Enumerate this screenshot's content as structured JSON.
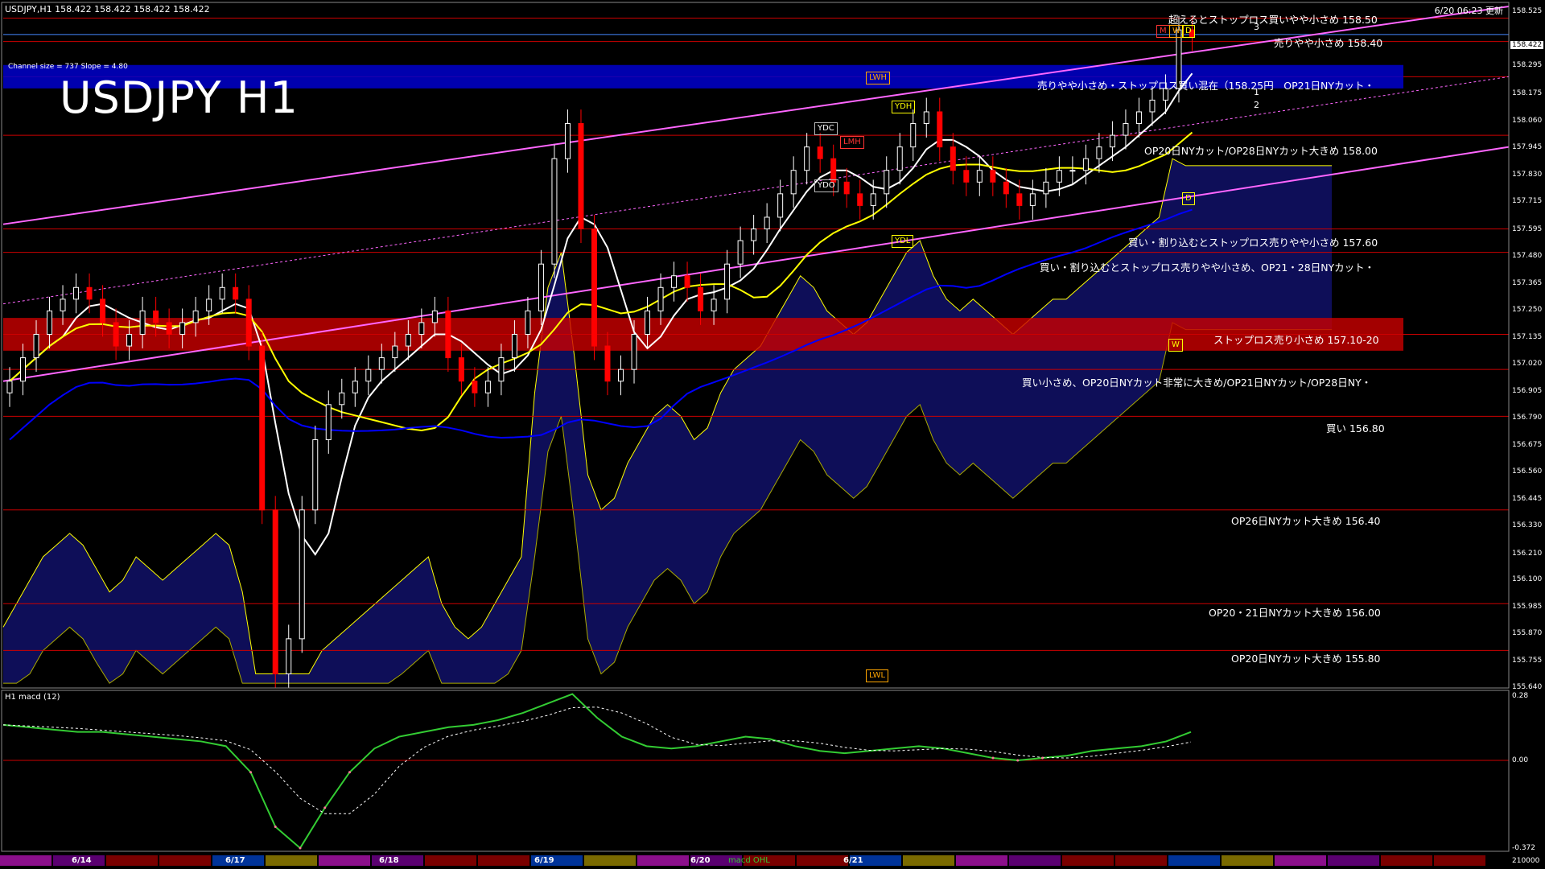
{
  "header": {
    "symbol_line": "USDJPY,H1  158.422 158.422 158.422 158.422",
    "updated": "6/20 06:23 更新",
    "channel_info": "Channel size = 737 Slope = 4.80",
    "title": "USDJPY H1",
    "macd_label": "H1  macd (12)"
  },
  "notes": [
    {
      "text": "超えるとストップロス買いやや小さめ 158.50",
      "price": 158.5
    },
    {
      "text": "売りやや小さめ 158.40",
      "price": 158.4
    },
    {
      "text": "売りやや小さめ・ストップロス買い混在（158.25円　OP21日NYカット・",
      "price": 158.25
    },
    {
      "text": "OP20日NYカット/OP28日NYカット大きめ 158.00",
      "price": 158.0
    },
    {
      "text": "買い・割り込むとストップロス売りやや小さめ 157.60",
      "price": 157.6
    },
    {
      "text": "買い・割り込むとストップロス売りやや小さめ、OP21・28日NYカット・",
      "price": 157.5
    },
    {
      "text": "ストップロス売り小さめ 157.10-20",
      "price": 157.15
    },
    {
      "text": "買い小さめ、OP20日NYカット非常に大きめ/OP21日NYカット/OP28日NY・",
      "price": 157.0
    },
    {
      "text": "買い 156.80",
      "price": 156.8
    },
    {
      "text": "OP26日NYカット大きめ 156.40",
      "price": 156.4
    },
    {
      "text": "OP20・21日NYカット大きめ 156.00",
      "price": 156.0
    },
    {
      "text": "OP20日NYカット大きめ 155.80",
      "price": 155.8
    }
  ],
  "tags": [
    {
      "text": "LWH",
      "style": "ora"
    },
    {
      "text": "YDH",
      "style": "yel"
    },
    {
      "text": "YDC",
      "style": "white"
    },
    {
      "text": "LMH",
      "style": "red"
    },
    {
      "text": "YDO",
      "style": "white"
    },
    {
      "text": "YDL",
      "style": "yel"
    },
    {
      "text": "LWL",
      "style": "ora"
    },
    {
      "text": "M",
      "style": "red"
    },
    {
      "text": "W",
      "style": "ora"
    },
    {
      "text": "D",
      "style": "yel"
    },
    {
      "text": "D",
      "style": "yel"
    },
    {
      "text": "W",
      "style": "yel"
    }
  ],
  "channel_labels": [
    "3",
    "1",
    "2"
  ],
  "price_axis": {
    "current": "158.422",
    "ticks": [
      "158.525",
      "158.295",
      "158.175",
      "158.060",
      "157.945",
      "157.830",
      "157.715",
      "157.595",
      "157.480",
      "157.365",
      "157.250",
      "157.135",
      "157.020",
      "156.905",
      "156.790",
      "156.675",
      "156.560",
      "156.445",
      "156.330",
      "156.210",
      "156.100",
      "155.985",
      "155.870",
      "155.755",
      "155.640"
    ]
  },
  "macd_axis": {
    "ticks": [
      "0.28",
      "0.00",
      "-0.372",
      "210000"
    ]
  },
  "date_labels": [
    "6/14",
    "6/17",
    "6/18",
    "6/19",
    "6/20",
    "6/21"
  ],
  "macd_ohl": "macd OHL",
  "colors": {
    "background": "#000000",
    "bull": "#ffffff",
    "bear": "#ff0000",
    "channel": "#ff66ff",
    "ma_short": "#ffffff",
    "ma_mid": "#ffff00",
    "ma_long": "#0000ff",
    "cloud": "#1a1aa0",
    "level": "#cc0000",
    "macd": "#33cc33",
    "macd_neg": "#ff7799"
  },
  "chart_data": {
    "type": "candlestick",
    "symbol": "USDJPY",
    "timeframe": "H1",
    "ylim": [
      155.64,
      158.55
    ],
    "levels": [
      158.5,
      158.4,
      158.25,
      158.0,
      157.6,
      157.5,
      157.15,
      157.0,
      156.8,
      156.4,
      156.0,
      155.8
    ],
    "close_series": [
      156.95,
      157.05,
      157.15,
      157.25,
      157.3,
      157.35,
      157.3,
      157.2,
      157.1,
      157.15,
      157.25,
      157.2,
      157.15,
      157.2,
      157.25,
      157.3,
      157.35,
      157.3,
      157.1,
      156.4,
      155.7,
      155.85,
      156.4,
      156.7,
      156.85,
      156.9,
      156.95,
      157.0,
      157.05,
      157.1,
      157.15,
      157.2,
      157.25,
      157.05,
      156.95,
      156.9,
      156.95,
      157.05,
      157.15,
      157.25,
      157.45,
      157.9,
      158.05,
      157.6,
      157.1,
      156.95,
      157.0,
      157.15,
      157.25,
      157.35,
      157.4,
      157.35,
      157.25,
      157.3,
      157.45,
      157.55,
      157.6,
      157.65,
      157.75,
      157.85,
      157.95,
      157.9,
      157.8,
      157.75,
      157.7,
      157.75,
      157.85,
      157.95,
      158.05,
      158.1,
      157.95,
      157.85,
      157.8,
      157.85,
      157.8,
      157.75,
      157.7,
      157.75,
      157.8,
      157.85,
      157.85,
      157.9,
      157.95,
      158.0,
      158.05,
      158.1,
      158.15,
      158.2,
      158.45,
      158.42
    ],
    "macd": [
      0.15,
      0.14,
      0.13,
      0.12,
      0.12,
      0.11,
      0.1,
      0.09,
      0.08,
      0.06,
      -0.05,
      -0.28,
      -0.37,
      -0.2,
      -0.05,
      0.05,
      0.1,
      0.12,
      0.14,
      0.15,
      0.17,
      0.2,
      0.24,
      0.28,
      0.18,
      0.1,
      0.06,
      0.05,
      0.06,
      0.08,
      0.1,
      0.09,
      0.06,
      0.04,
      0.03,
      0.04,
      0.05,
      0.06,
      0.05,
      0.03,
      0.01,
      0.0,
      0.01,
      0.02,
      0.04,
      0.05,
      0.06,
      0.08,
      0.12
    ]
  }
}
